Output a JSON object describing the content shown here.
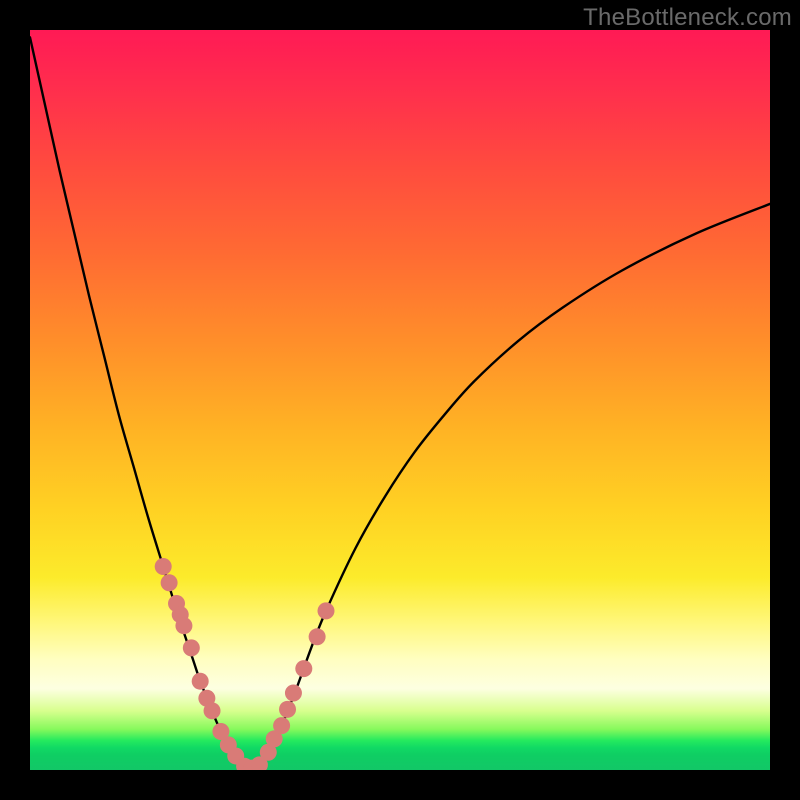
{
  "watermark": "TheBottleneck.com",
  "colors": {
    "curve_stroke": "#000000",
    "dot_fill": "#d97b77",
    "dot_stroke": "#c65e5a"
  },
  "chart_data": {
    "type": "line",
    "title": "",
    "xlabel": "",
    "ylabel": "",
    "xlim": [
      0,
      100
    ],
    "ylim": [
      0,
      100
    ],
    "series": [
      {
        "name": "bottleneck-curve",
        "x": [
          0,
          2,
          4,
          6,
          8,
          10,
          12,
          14,
          16,
          18,
          20,
          22,
          23,
          24,
          25,
          26,
          27,
          28,
          29,
          30,
          31,
          32,
          34,
          36,
          38,
          40,
          44,
          48,
          52,
          56,
          60,
          66,
          72,
          80,
          90,
          100
        ],
        "y": [
          99,
          90,
          81,
          72.5,
          64,
          56,
          48,
          41,
          34,
          27.5,
          21,
          15,
          12,
          9.5,
          7,
          4.8,
          3.0,
          1.6,
          0.7,
          0.25,
          0.7,
          2.0,
          6.0,
          11.0,
          16.5,
          21.5,
          30.0,
          37.0,
          43.0,
          48.0,
          52.5,
          58.0,
          62.5,
          67.5,
          72.5,
          76.5
        ]
      }
    ],
    "dots": {
      "name": "highlighted-points",
      "x": [
        18.0,
        18.8,
        19.8,
        20.3,
        20.8,
        21.8,
        23.0,
        23.9,
        24.6,
        25.8,
        26.8,
        27.8,
        29.0,
        30.0,
        31.0,
        32.2,
        33.0,
        34.0,
        34.8,
        35.6,
        37.0,
        38.8,
        40.0
      ],
      "y": [
        27.5,
        25.3,
        22.5,
        21.0,
        19.5,
        16.5,
        12.0,
        9.7,
        8.0,
        5.2,
        3.4,
        1.9,
        0.5,
        0.25,
        0.7,
        2.4,
        4.2,
        6.0,
        8.2,
        10.4,
        13.7,
        18.0,
        21.5
      ]
    }
  }
}
